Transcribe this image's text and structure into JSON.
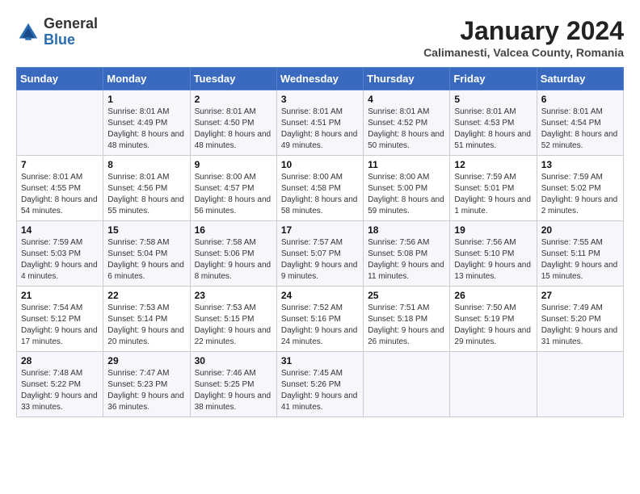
{
  "logo": {
    "general": "General",
    "blue": "Blue"
  },
  "header": {
    "month_year": "January 2024",
    "location": "Calimanesti, Valcea County, Romania"
  },
  "weekdays": [
    "Sunday",
    "Monday",
    "Tuesday",
    "Wednesday",
    "Thursday",
    "Friday",
    "Saturday"
  ],
  "weeks": [
    [
      {
        "day": "",
        "sunrise": "",
        "sunset": "",
        "daylight": ""
      },
      {
        "day": "1",
        "sunrise": "Sunrise: 8:01 AM",
        "sunset": "Sunset: 4:49 PM",
        "daylight": "Daylight: 8 hours and 48 minutes."
      },
      {
        "day": "2",
        "sunrise": "Sunrise: 8:01 AM",
        "sunset": "Sunset: 4:50 PM",
        "daylight": "Daylight: 8 hours and 48 minutes."
      },
      {
        "day": "3",
        "sunrise": "Sunrise: 8:01 AM",
        "sunset": "Sunset: 4:51 PM",
        "daylight": "Daylight: 8 hours and 49 minutes."
      },
      {
        "day": "4",
        "sunrise": "Sunrise: 8:01 AM",
        "sunset": "Sunset: 4:52 PM",
        "daylight": "Daylight: 8 hours and 50 minutes."
      },
      {
        "day": "5",
        "sunrise": "Sunrise: 8:01 AM",
        "sunset": "Sunset: 4:53 PM",
        "daylight": "Daylight: 8 hours and 51 minutes."
      },
      {
        "day": "6",
        "sunrise": "Sunrise: 8:01 AM",
        "sunset": "Sunset: 4:54 PM",
        "daylight": "Daylight: 8 hours and 52 minutes."
      }
    ],
    [
      {
        "day": "7",
        "sunrise": "Sunrise: 8:01 AM",
        "sunset": "Sunset: 4:55 PM",
        "daylight": "Daylight: 8 hours and 54 minutes."
      },
      {
        "day": "8",
        "sunrise": "Sunrise: 8:01 AM",
        "sunset": "Sunset: 4:56 PM",
        "daylight": "Daylight: 8 hours and 55 minutes."
      },
      {
        "day": "9",
        "sunrise": "Sunrise: 8:00 AM",
        "sunset": "Sunset: 4:57 PM",
        "daylight": "Daylight: 8 hours and 56 minutes."
      },
      {
        "day": "10",
        "sunrise": "Sunrise: 8:00 AM",
        "sunset": "Sunset: 4:58 PM",
        "daylight": "Daylight: 8 hours and 58 minutes."
      },
      {
        "day": "11",
        "sunrise": "Sunrise: 8:00 AM",
        "sunset": "Sunset: 5:00 PM",
        "daylight": "Daylight: 8 hours and 59 minutes."
      },
      {
        "day": "12",
        "sunrise": "Sunrise: 7:59 AM",
        "sunset": "Sunset: 5:01 PM",
        "daylight": "Daylight: 9 hours and 1 minute."
      },
      {
        "day": "13",
        "sunrise": "Sunrise: 7:59 AM",
        "sunset": "Sunset: 5:02 PM",
        "daylight": "Daylight: 9 hours and 2 minutes."
      }
    ],
    [
      {
        "day": "14",
        "sunrise": "Sunrise: 7:59 AM",
        "sunset": "Sunset: 5:03 PM",
        "daylight": "Daylight: 9 hours and 4 minutes."
      },
      {
        "day": "15",
        "sunrise": "Sunrise: 7:58 AM",
        "sunset": "Sunset: 5:04 PM",
        "daylight": "Daylight: 9 hours and 6 minutes."
      },
      {
        "day": "16",
        "sunrise": "Sunrise: 7:58 AM",
        "sunset": "Sunset: 5:06 PM",
        "daylight": "Daylight: 9 hours and 8 minutes."
      },
      {
        "day": "17",
        "sunrise": "Sunrise: 7:57 AM",
        "sunset": "Sunset: 5:07 PM",
        "daylight": "Daylight: 9 hours and 9 minutes."
      },
      {
        "day": "18",
        "sunrise": "Sunrise: 7:56 AM",
        "sunset": "Sunset: 5:08 PM",
        "daylight": "Daylight: 9 hours and 11 minutes."
      },
      {
        "day": "19",
        "sunrise": "Sunrise: 7:56 AM",
        "sunset": "Sunset: 5:10 PM",
        "daylight": "Daylight: 9 hours and 13 minutes."
      },
      {
        "day": "20",
        "sunrise": "Sunrise: 7:55 AM",
        "sunset": "Sunset: 5:11 PM",
        "daylight": "Daylight: 9 hours and 15 minutes."
      }
    ],
    [
      {
        "day": "21",
        "sunrise": "Sunrise: 7:54 AM",
        "sunset": "Sunset: 5:12 PM",
        "daylight": "Daylight: 9 hours and 17 minutes."
      },
      {
        "day": "22",
        "sunrise": "Sunrise: 7:53 AM",
        "sunset": "Sunset: 5:14 PM",
        "daylight": "Daylight: 9 hours and 20 minutes."
      },
      {
        "day": "23",
        "sunrise": "Sunrise: 7:53 AM",
        "sunset": "Sunset: 5:15 PM",
        "daylight": "Daylight: 9 hours and 22 minutes."
      },
      {
        "day": "24",
        "sunrise": "Sunrise: 7:52 AM",
        "sunset": "Sunset: 5:16 PM",
        "daylight": "Daylight: 9 hours and 24 minutes."
      },
      {
        "day": "25",
        "sunrise": "Sunrise: 7:51 AM",
        "sunset": "Sunset: 5:18 PM",
        "daylight": "Daylight: 9 hours and 26 minutes."
      },
      {
        "day": "26",
        "sunrise": "Sunrise: 7:50 AM",
        "sunset": "Sunset: 5:19 PM",
        "daylight": "Daylight: 9 hours and 29 minutes."
      },
      {
        "day": "27",
        "sunrise": "Sunrise: 7:49 AM",
        "sunset": "Sunset: 5:20 PM",
        "daylight": "Daylight: 9 hours and 31 minutes."
      }
    ],
    [
      {
        "day": "28",
        "sunrise": "Sunrise: 7:48 AM",
        "sunset": "Sunset: 5:22 PM",
        "daylight": "Daylight: 9 hours and 33 minutes."
      },
      {
        "day": "29",
        "sunrise": "Sunrise: 7:47 AM",
        "sunset": "Sunset: 5:23 PM",
        "daylight": "Daylight: 9 hours and 36 minutes."
      },
      {
        "day": "30",
        "sunrise": "Sunrise: 7:46 AM",
        "sunset": "Sunset: 5:25 PM",
        "daylight": "Daylight: 9 hours and 38 minutes."
      },
      {
        "day": "31",
        "sunrise": "Sunrise: 7:45 AM",
        "sunset": "Sunset: 5:26 PM",
        "daylight": "Daylight: 9 hours and 41 minutes."
      },
      {
        "day": "",
        "sunrise": "",
        "sunset": "",
        "daylight": ""
      },
      {
        "day": "",
        "sunrise": "",
        "sunset": "",
        "daylight": ""
      },
      {
        "day": "",
        "sunrise": "",
        "sunset": "",
        "daylight": ""
      }
    ]
  ]
}
